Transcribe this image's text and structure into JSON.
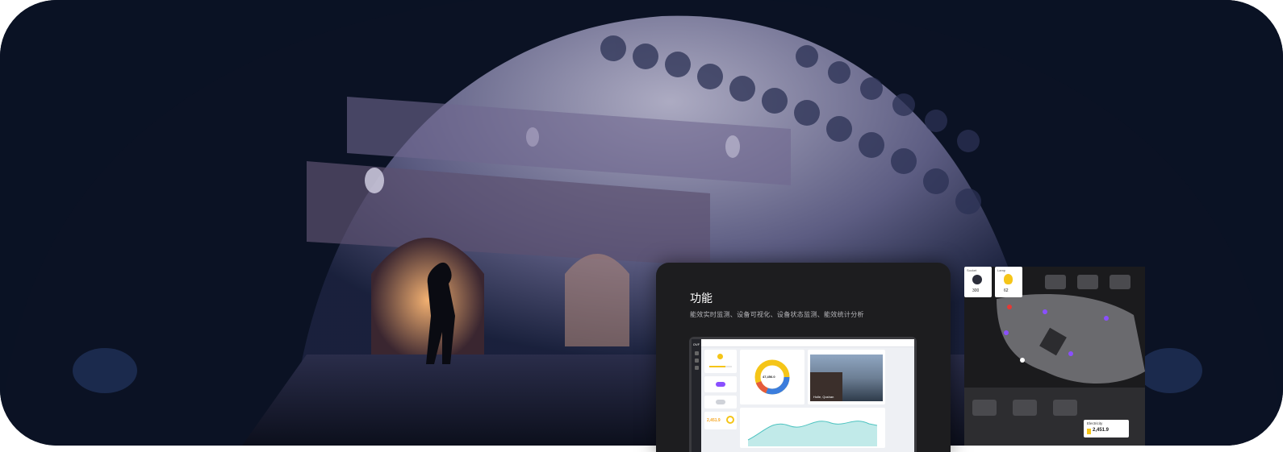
{
  "feature": {
    "title": "功能",
    "description": "能效实时监测、设备可视化、设备状态监测、能效统计分析"
  },
  "dashboard": {
    "logo_text": "OVF",
    "donut_value": "47,456.0",
    "energy_value": "2,451.9",
    "photo_caption": "Holle, Qushan"
  },
  "map": {
    "card1_label": "Socket",
    "card1_value": "300",
    "card2_label": "Lamp",
    "card2_value": "62",
    "electricity_label": "Electricity",
    "electricity_value": "2,451.9"
  },
  "colors": {
    "accent_yellow": "#f5c518",
    "accent_purple": "#8a4fff",
    "accent_blue": "#3b7ddd",
    "accent_teal": "#4ec3c0",
    "status_red": "#e53935"
  },
  "icons": [
    "bulb-icon",
    "socket-icon",
    "lamp-icon",
    "bolt-icon",
    "gear-icon"
  ]
}
